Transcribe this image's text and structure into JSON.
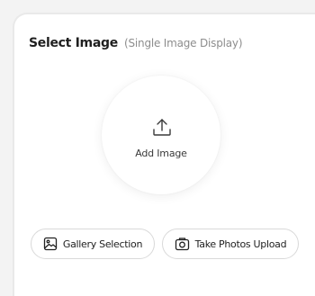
{
  "header": {
    "title": "Select Image",
    "subtitle": "(Single Image Display)"
  },
  "upload": {
    "label": "Add Image",
    "icon": "upload-icon"
  },
  "actions": {
    "gallery": {
      "label": "Gallery Selection",
      "icon": "image-icon"
    },
    "camera": {
      "label": "Take Photos Upload",
      "icon": "camera-icon"
    }
  },
  "colors": {
    "text": "#1f1f1f",
    "muted": "#8d8d8d",
    "border": "#d9d9d9"
  }
}
